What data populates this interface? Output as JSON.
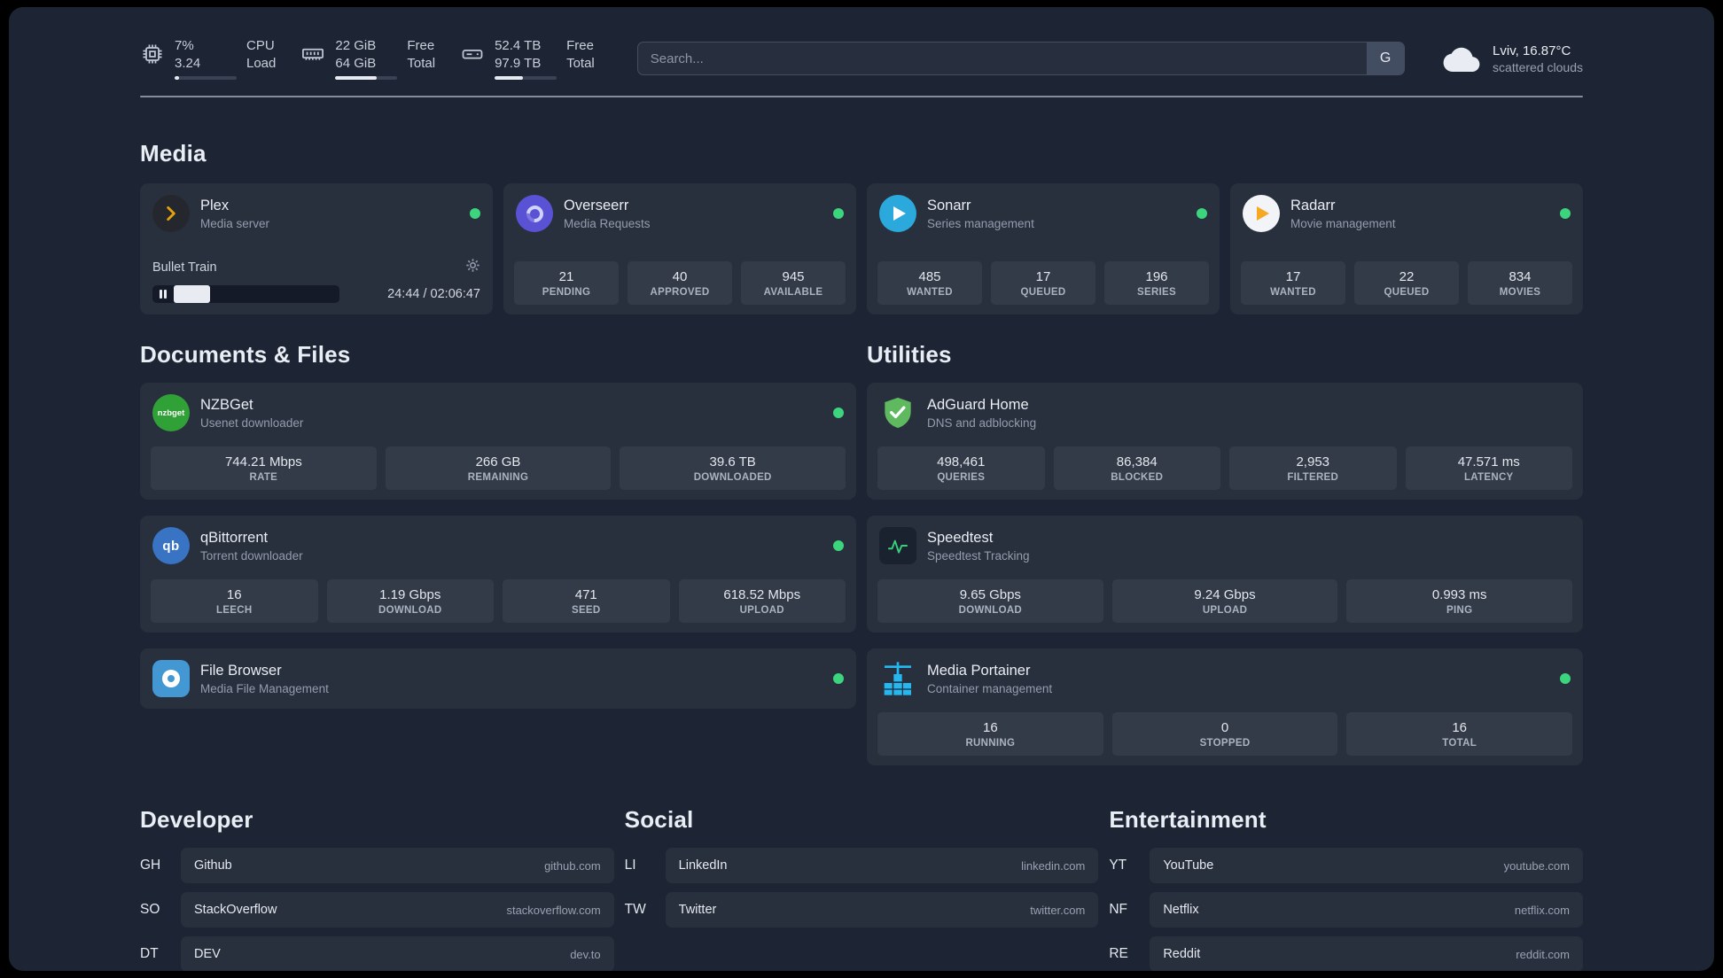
{
  "topbar": {
    "cpu": {
      "value1": "7%",
      "value2": "3.24",
      "label1": "CPU",
      "label2": "Load",
      "bar": 7
    },
    "memory": {
      "value1": "22 GiB",
      "value2": "64 GiB",
      "label1": "Free",
      "label2": "Total",
      "bar": 66
    },
    "disk": {
      "value1": "52.4 TB",
      "value2": "97.9 TB",
      "label1": "Free",
      "label2": "Total",
      "bar": 46
    },
    "search": {
      "placeholder": "Search...",
      "button_label": "G"
    },
    "weather": {
      "line1": "Lviv, 16.87°C",
      "line2": "scattered clouds"
    }
  },
  "sections": {
    "media": {
      "title": "Media"
    },
    "documents": {
      "title": "Documents & Files"
    },
    "utilities": {
      "title": "Utilities"
    }
  },
  "services": {
    "plex": {
      "name": "Plex",
      "desc": "Media server",
      "now_playing": "Bullet Train",
      "time": "24:44 / 02:06:47",
      "progress": 19.5
    },
    "overseerr": {
      "name": "Overseerr",
      "desc": "Media Requests",
      "stats": [
        {
          "value": "21",
          "label": "PENDING"
        },
        {
          "value": "40",
          "label": "APPROVED"
        },
        {
          "value": "945",
          "label": "AVAILABLE"
        }
      ]
    },
    "sonarr": {
      "name": "Sonarr",
      "desc": "Series management",
      "stats": [
        {
          "value": "485",
          "label": "WANTED"
        },
        {
          "value": "17",
          "label": "QUEUED"
        },
        {
          "value": "196",
          "label": "SERIES"
        }
      ]
    },
    "radarr": {
      "name": "Radarr",
      "desc": "Movie management",
      "stats": [
        {
          "value": "17",
          "label": "WANTED"
        },
        {
          "value": "22",
          "label": "QUEUED"
        },
        {
          "value": "834",
          "label": "MOVIES"
        }
      ]
    },
    "nzbget": {
      "name": "NZBGet",
      "desc": "Usenet downloader",
      "icon_text": "nzbget",
      "stats": [
        {
          "value": "744.21 Mbps",
          "label": "RATE"
        },
        {
          "value": "266 GB",
          "label": "REMAINING"
        },
        {
          "value": "39.6 TB",
          "label": "DOWNLOADED"
        }
      ]
    },
    "qbittorrent": {
      "name": "qBittorrent",
      "desc": "Torrent downloader",
      "icon_text": "qb",
      "stats": [
        {
          "value": "16",
          "label": "LEECH"
        },
        {
          "value": "1.19 Gbps",
          "label": "DOWNLOAD"
        },
        {
          "value": "471",
          "label": "SEED"
        },
        {
          "value": "618.52 Mbps",
          "label": "UPLOAD"
        }
      ]
    },
    "filebrowser": {
      "name": "File Browser",
      "desc": "Media File Management"
    },
    "adguard": {
      "name": "AdGuard Home",
      "desc": "DNS and adblocking",
      "stats": [
        {
          "value": "498,461",
          "label": "QUERIES"
        },
        {
          "value": "86,384",
          "label": "BLOCKED"
        },
        {
          "value": "2,953",
          "label": "FILTERED"
        },
        {
          "value": "47.571 ms",
          "label": "LATENCY"
        }
      ]
    },
    "speedtest": {
      "name": "Speedtest",
      "desc": "Speedtest Tracking",
      "stats": [
        {
          "value": "9.65 Gbps",
          "label": "DOWNLOAD"
        },
        {
          "value": "9.24 Gbps",
          "label": "UPLOAD"
        },
        {
          "value": "0.993 ms",
          "label": "PING"
        }
      ]
    },
    "portainer": {
      "name": "Media Portainer",
      "desc": "Container management",
      "stats": [
        {
          "value": "16",
          "label": "RUNNING"
        },
        {
          "value": "0",
          "label": "STOPPED"
        },
        {
          "value": "16",
          "label": "TOTAL"
        }
      ]
    }
  },
  "bookmarks": {
    "developer": {
      "title": "Developer",
      "items": [
        {
          "abbr": "GH",
          "name": "Github",
          "url": "github.com"
        },
        {
          "abbr": "SO",
          "name": "StackOverflow",
          "url": "stackoverflow.com"
        },
        {
          "abbr": "DT",
          "name": "DEV",
          "url": "dev.to"
        }
      ]
    },
    "social": {
      "title": "Social",
      "items": [
        {
          "abbr": "LI",
          "name": "LinkedIn",
          "url": "linkedin.com"
        },
        {
          "abbr": "TW",
          "name": "Twitter",
          "url": "twitter.com"
        }
      ]
    },
    "entertainment": {
      "title": "Entertainment",
      "items": [
        {
          "abbr": "YT",
          "name": "YouTube",
          "url": "youtube.com"
        },
        {
          "abbr": "NF",
          "name": "Netflix",
          "url": "netflix.com"
        },
        {
          "abbr": "RE",
          "name": "Reddit",
          "url": "reddit.com"
        }
      ]
    }
  }
}
